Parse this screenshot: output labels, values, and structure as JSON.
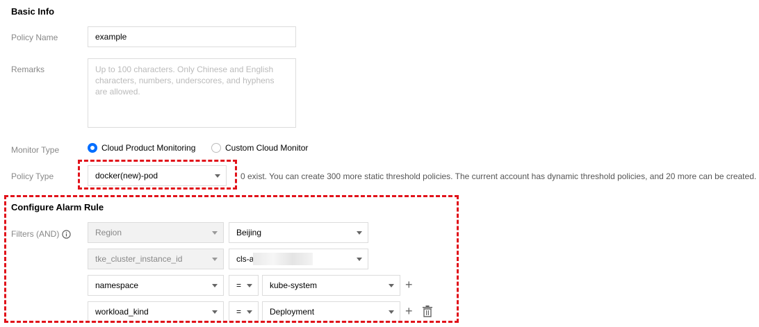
{
  "basic_info": {
    "title": "Basic Info",
    "policy_name": {
      "label": "Policy Name",
      "value": "example"
    },
    "remarks": {
      "label": "Remarks",
      "placeholder": "Up to 100 characters. Only Chinese and English characters, numbers, underscores, and hyphens are allowed."
    },
    "monitor_type": {
      "label": "Monitor Type",
      "options": [
        {
          "label": "Cloud Product Monitoring",
          "checked": true
        },
        {
          "label": "Custom Cloud Monitor",
          "checked": false
        }
      ]
    },
    "policy_type": {
      "label": "Policy Type",
      "value": "docker(new)-pod",
      "hint": "0 exist. You can create 300 more static threshold policies. The current account has dynamic threshold policies, and 20 more can be created."
    }
  },
  "alarm_rule": {
    "title": "Configure Alarm Rule",
    "filters_label": "Filters (AND)",
    "info_icon": "info-circle-icon",
    "filters": [
      {
        "key": "Region",
        "operator": "",
        "value": "Beijing",
        "key_disabled": true
      },
      {
        "key": "tke_cluster_instance_id",
        "operator": "",
        "value": "cls-a",
        "key_disabled": true
      },
      {
        "key": "namespace",
        "operator": "=",
        "value": "kube-system",
        "key_disabled": false
      },
      {
        "key": "workload_kind",
        "operator": "=",
        "value": "Deployment",
        "key_disabled": false
      }
    ],
    "add_symbol": "+"
  },
  "colors": {
    "accent": "#006eff",
    "highlight_border": "#e1121a",
    "label": "#888888"
  }
}
